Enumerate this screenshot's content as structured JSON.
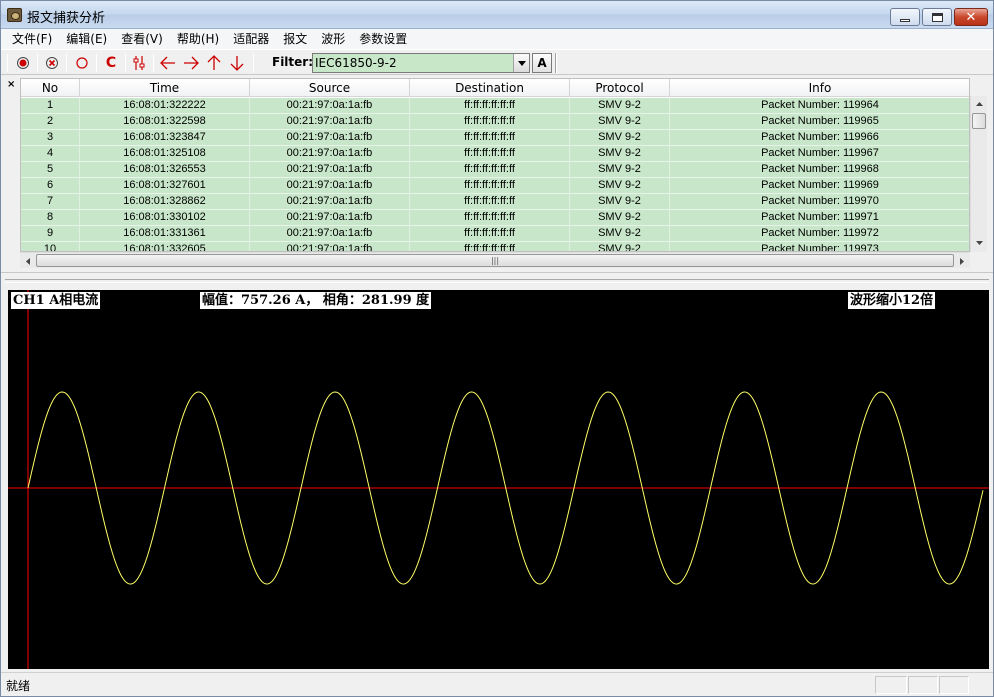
{
  "window": {
    "title": "报文捕获分析"
  },
  "menu": [
    "文件(F)",
    "编辑(E)",
    "查看(V)",
    "帮助(H)",
    "适配器",
    "报文",
    "波形",
    "参数设置"
  ],
  "toolbar": {
    "icons": [
      "record-icon",
      "stop-icon",
      "open-icon",
      "clear-icon",
      "settings-icon",
      "arrow-left-icon",
      "arrow-right-icon",
      "arrow-up-icon",
      "arrow-down-icon"
    ],
    "accent": "#cc0000",
    "clear_label": "C",
    "filter_label": "Filter:",
    "filter_value": "IEC61850-9-2",
    "apply_label": "A"
  },
  "packet_list": {
    "close_label": "×",
    "columns": [
      "No",
      "Time",
      "Source",
      "Destination",
      "Protocol",
      "Info"
    ],
    "row_color": "#c8e6c9",
    "rows": [
      [
        "1",
        "16:08:01:322222",
        "00:21:97:0a:1a:fb",
        "ff:ff:ff:ff:ff:ff",
        "SMV 9-2",
        "Packet Number: 119964"
      ],
      [
        "2",
        "16:08:01:322598",
        "00:21:97:0a:1a:fb",
        "ff:ff:ff:ff:ff:ff",
        "SMV 9-2",
        "Packet Number: 119965"
      ],
      [
        "3",
        "16:08:01:323847",
        "00:21:97:0a:1a:fb",
        "ff:ff:ff:ff:ff:ff",
        "SMV 9-2",
        "Packet Number: 119966"
      ],
      [
        "4",
        "16:08:01:325108",
        "00:21:97:0a:1a:fb",
        "ff:ff:ff:ff:ff:ff",
        "SMV 9-2",
        "Packet Number: 119967"
      ],
      [
        "5",
        "16:08:01:326553",
        "00:21:97:0a:1a:fb",
        "ff:ff:ff:ff:ff:ff",
        "SMV 9-2",
        "Packet Number: 119968"
      ],
      [
        "6",
        "16:08:01:327601",
        "00:21:97:0a:1a:fb",
        "ff:ff:ff:ff:ff:ff",
        "SMV 9-2",
        "Packet Number: 119969"
      ],
      [
        "7",
        "16:08:01:328862",
        "00:21:97:0a:1a:fb",
        "ff:ff:ff:ff:ff:ff",
        "SMV 9-2",
        "Packet Number: 119970"
      ],
      [
        "8",
        "16:08:01:330102",
        "00:21:97:0a:1a:fb",
        "ff:ff:ff:ff:ff:ff",
        "SMV 9-2",
        "Packet Number: 119971"
      ],
      [
        "9",
        "16:08:01:331361",
        "00:21:97:0a:1a:fb",
        "ff:ff:ff:ff:ff:ff",
        "SMV 9-2",
        "Packet Number: 119972"
      ],
      [
        "10",
        "16:08:01:332605",
        "00:21:97:0a:1a:fb",
        "ff:ff:ff:ff:ff:ff",
        "SMV 9-2",
        "Packet Number: 119973"
      ]
    ]
  },
  "waveform": {
    "channel_label": "CH1 A相电流",
    "amplitude_label": "幅值：757.26 A， 相角：281.99 度",
    "zoom_label": "波形缩小12倍",
    "background": "#000000",
    "axis_color": "#ff0000",
    "wave_color": "#ffff66",
    "cycles_shown": 7
  },
  "status": {
    "text": "就绪"
  }
}
